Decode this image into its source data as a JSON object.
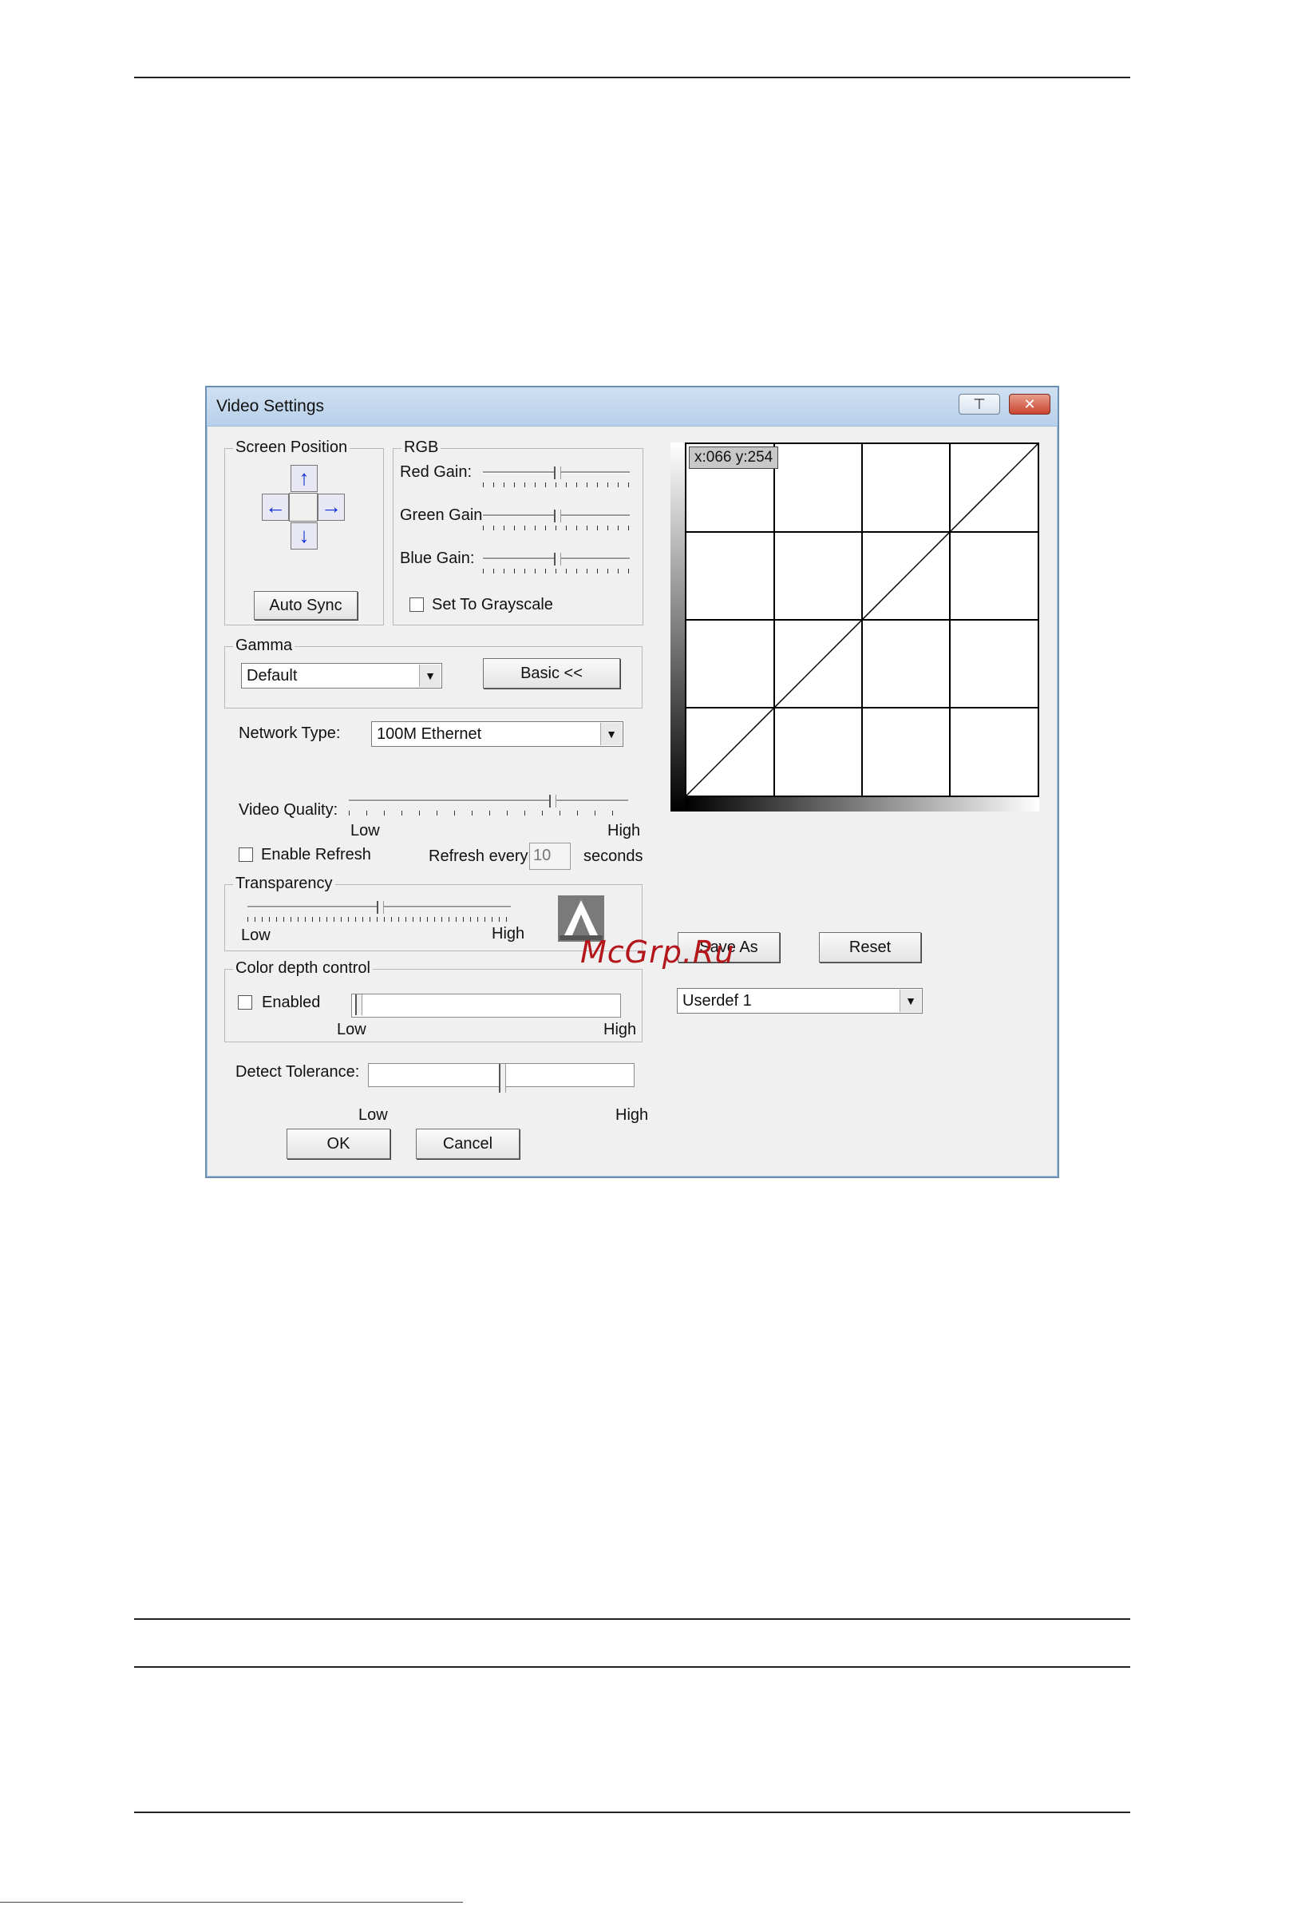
{
  "window": {
    "title": "Video Settings",
    "pin_glyph": "⊤",
    "close_glyph": "✕"
  },
  "screen_position": {
    "legend": "Screen Position",
    "auto_sync_label": "Auto Sync"
  },
  "rgb": {
    "legend": "RGB",
    "red_gain_label": "Red Gain:",
    "red_gain_level": 0.5,
    "green_gain_label": "Green Gain",
    "green_gain_level": 0.5,
    "blue_gain_label": "Blue Gain:",
    "blue_gain_level": 0.5,
    "grayscale_label": "Set To Grayscale",
    "grayscale_checked": false
  },
  "gamma": {
    "legend": "Gamma",
    "selected": "Default",
    "basic_label": "Basic <<"
  },
  "network": {
    "label": "Network Type:",
    "selected": "100M Ethernet"
  },
  "video_quality": {
    "label": "Video Quality:",
    "low": "Low",
    "high": "High",
    "level": 0.73
  },
  "refresh": {
    "enable_label": "Enable Refresh",
    "enabled": false,
    "every_label": "Refresh every",
    "value": "10",
    "seconds_label": "seconds"
  },
  "transparency": {
    "legend": "Transparency",
    "low": "Low",
    "high": "High",
    "level": 0.5
  },
  "color_depth": {
    "legend": "Color depth control",
    "enabled_label": "Enabled",
    "enabled": false,
    "low": "Low",
    "high": "High"
  },
  "detect_tolerance": {
    "label": "Detect Tolerance:",
    "low": "Low",
    "high": "High",
    "level": 0.5
  },
  "gamma_curve": {
    "readout": "x:066 y:254"
  },
  "profile": {
    "save_as_label": "Save As",
    "reset_label": "Reset",
    "selected": "Userdef 1"
  },
  "footer": {
    "ok_label": "OK",
    "cancel_label": "Cancel"
  },
  "watermark": {
    "text": "McGrp.Ru"
  },
  "colors": {
    "arrow_blue": "#0b2bd6",
    "watermark_red": "#b3161b",
    "titlebar": "#c4d9ee"
  }
}
